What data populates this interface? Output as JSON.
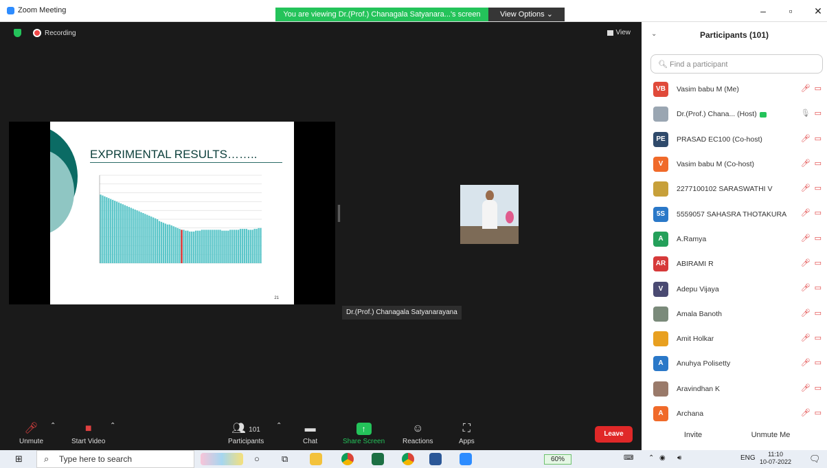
{
  "window": {
    "title": "Zoom Meeting",
    "viewing_banner": "You are viewing Dr.(Prof.) Chanagala Satyanara...'s screen",
    "view_options": "View Options",
    "minimize": "–",
    "maximize": "▫",
    "close": "✕"
  },
  "meeting": {
    "recording_label": "Recording",
    "view_label": "View",
    "speaker_name": "Dr.(Prof.) Chanagala Satyanarayana"
  },
  "slide": {
    "title": "EXPRIMENTAL RESULTS……..",
    "page_number": "21",
    "chart_data": {
      "type": "bar",
      "ylim": [
        0,
        1.0
      ],
      "grid": true,
      "values": [
        0.78,
        0.77,
        0.76,
        0.75,
        0.74,
        0.73,
        0.72,
        0.71,
        0.7,
        0.69,
        0.68,
        0.67,
        0.66,
        0.65,
        0.64,
        0.63,
        0.62,
        0.61,
        0.6,
        0.59,
        0.58,
        0.57,
        0.56,
        0.55,
        0.54,
        0.53,
        0.52,
        0.51,
        0.5,
        0.48,
        0.47,
        0.46,
        0.45,
        0.44,
        0.44,
        0.43,
        0.42,
        0.41,
        0.4,
        0.39,
        0.38,
        0.38,
        0.37,
        0.37,
        0.36,
        0.36,
        0.36,
        0.37,
        0.37,
        0.37,
        0.38,
        0.38,
        0.38,
        0.38,
        0.38,
        0.38,
        0.38,
        0.38,
        0.38,
        0.38,
        0.37,
        0.37,
        0.37,
        0.37,
        0.38,
        0.38,
        0.38,
        0.38,
        0.38,
        0.39,
        0.39,
        0.39,
        0.39,
        0.38,
        0.38,
        0.38,
        0.39,
        0.39,
        0.4,
        0.4
      ],
      "highlight_index": 40
    }
  },
  "toolbar": {
    "unmute": "Unmute",
    "start_video": "Start Video",
    "participants": "Participants",
    "participant_count": "101",
    "chat": "Chat",
    "share_screen": "Share Screen",
    "reactions": "Reactions",
    "apps": "Apps",
    "leave": "Leave"
  },
  "panel": {
    "title": "Participants (101)",
    "search_placeholder": "Find a participant",
    "invite": "Invite",
    "unmute_me": "Unmute Me",
    "participants": [
      {
        "initials": "VB",
        "name": "Vasim babu M (Me)",
        "color": "#e04a3a"
      },
      {
        "initials": "",
        "name": "Dr.(Prof.) Chana... (Host)",
        "color": "#9aa6b2"
      },
      {
        "initials": "PE",
        "name": "PRASAD EC100 (Co-host)",
        "color": "#2f4a6b"
      },
      {
        "initials": "V",
        "name": "Vasim babu M (Co-host)",
        "color": "#f06a2a"
      },
      {
        "initials": "",
        "name": "2277100102 SARASWATHI V",
        "color": "#c7a03a"
      },
      {
        "initials": "5S",
        "name": "5559057 SAHASRA THOTAKURA",
        "color": "#2a78c8"
      },
      {
        "initials": "A",
        "name": "A.Ramya",
        "color": "#24a05a"
      },
      {
        "initials": "AR",
        "name": "ABIRAMI R",
        "color": "#d63a3a"
      },
      {
        "initials": "V",
        "name": "Adepu Vijaya",
        "color": "#4a4a72"
      },
      {
        "initials": "",
        "name": "Amala Banoth",
        "color": "#7a8a7a"
      },
      {
        "initials": "",
        "name": "Amit Holkar",
        "color": "#e8a020"
      },
      {
        "initials": "A",
        "name": "Anuhya Polisetty",
        "color": "#2a78c8"
      },
      {
        "initials": "",
        "name": "Aravindhan K",
        "color": "#9a7a6a"
      },
      {
        "initials": "A",
        "name": "Archana",
        "color": "#f06a2a"
      }
    ]
  },
  "taskbar": {
    "search_text": "Type here to search",
    "battery": "60%",
    "lang": "ENG",
    "time": "11:10",
    "date": "10-07-2022"
  }
}
